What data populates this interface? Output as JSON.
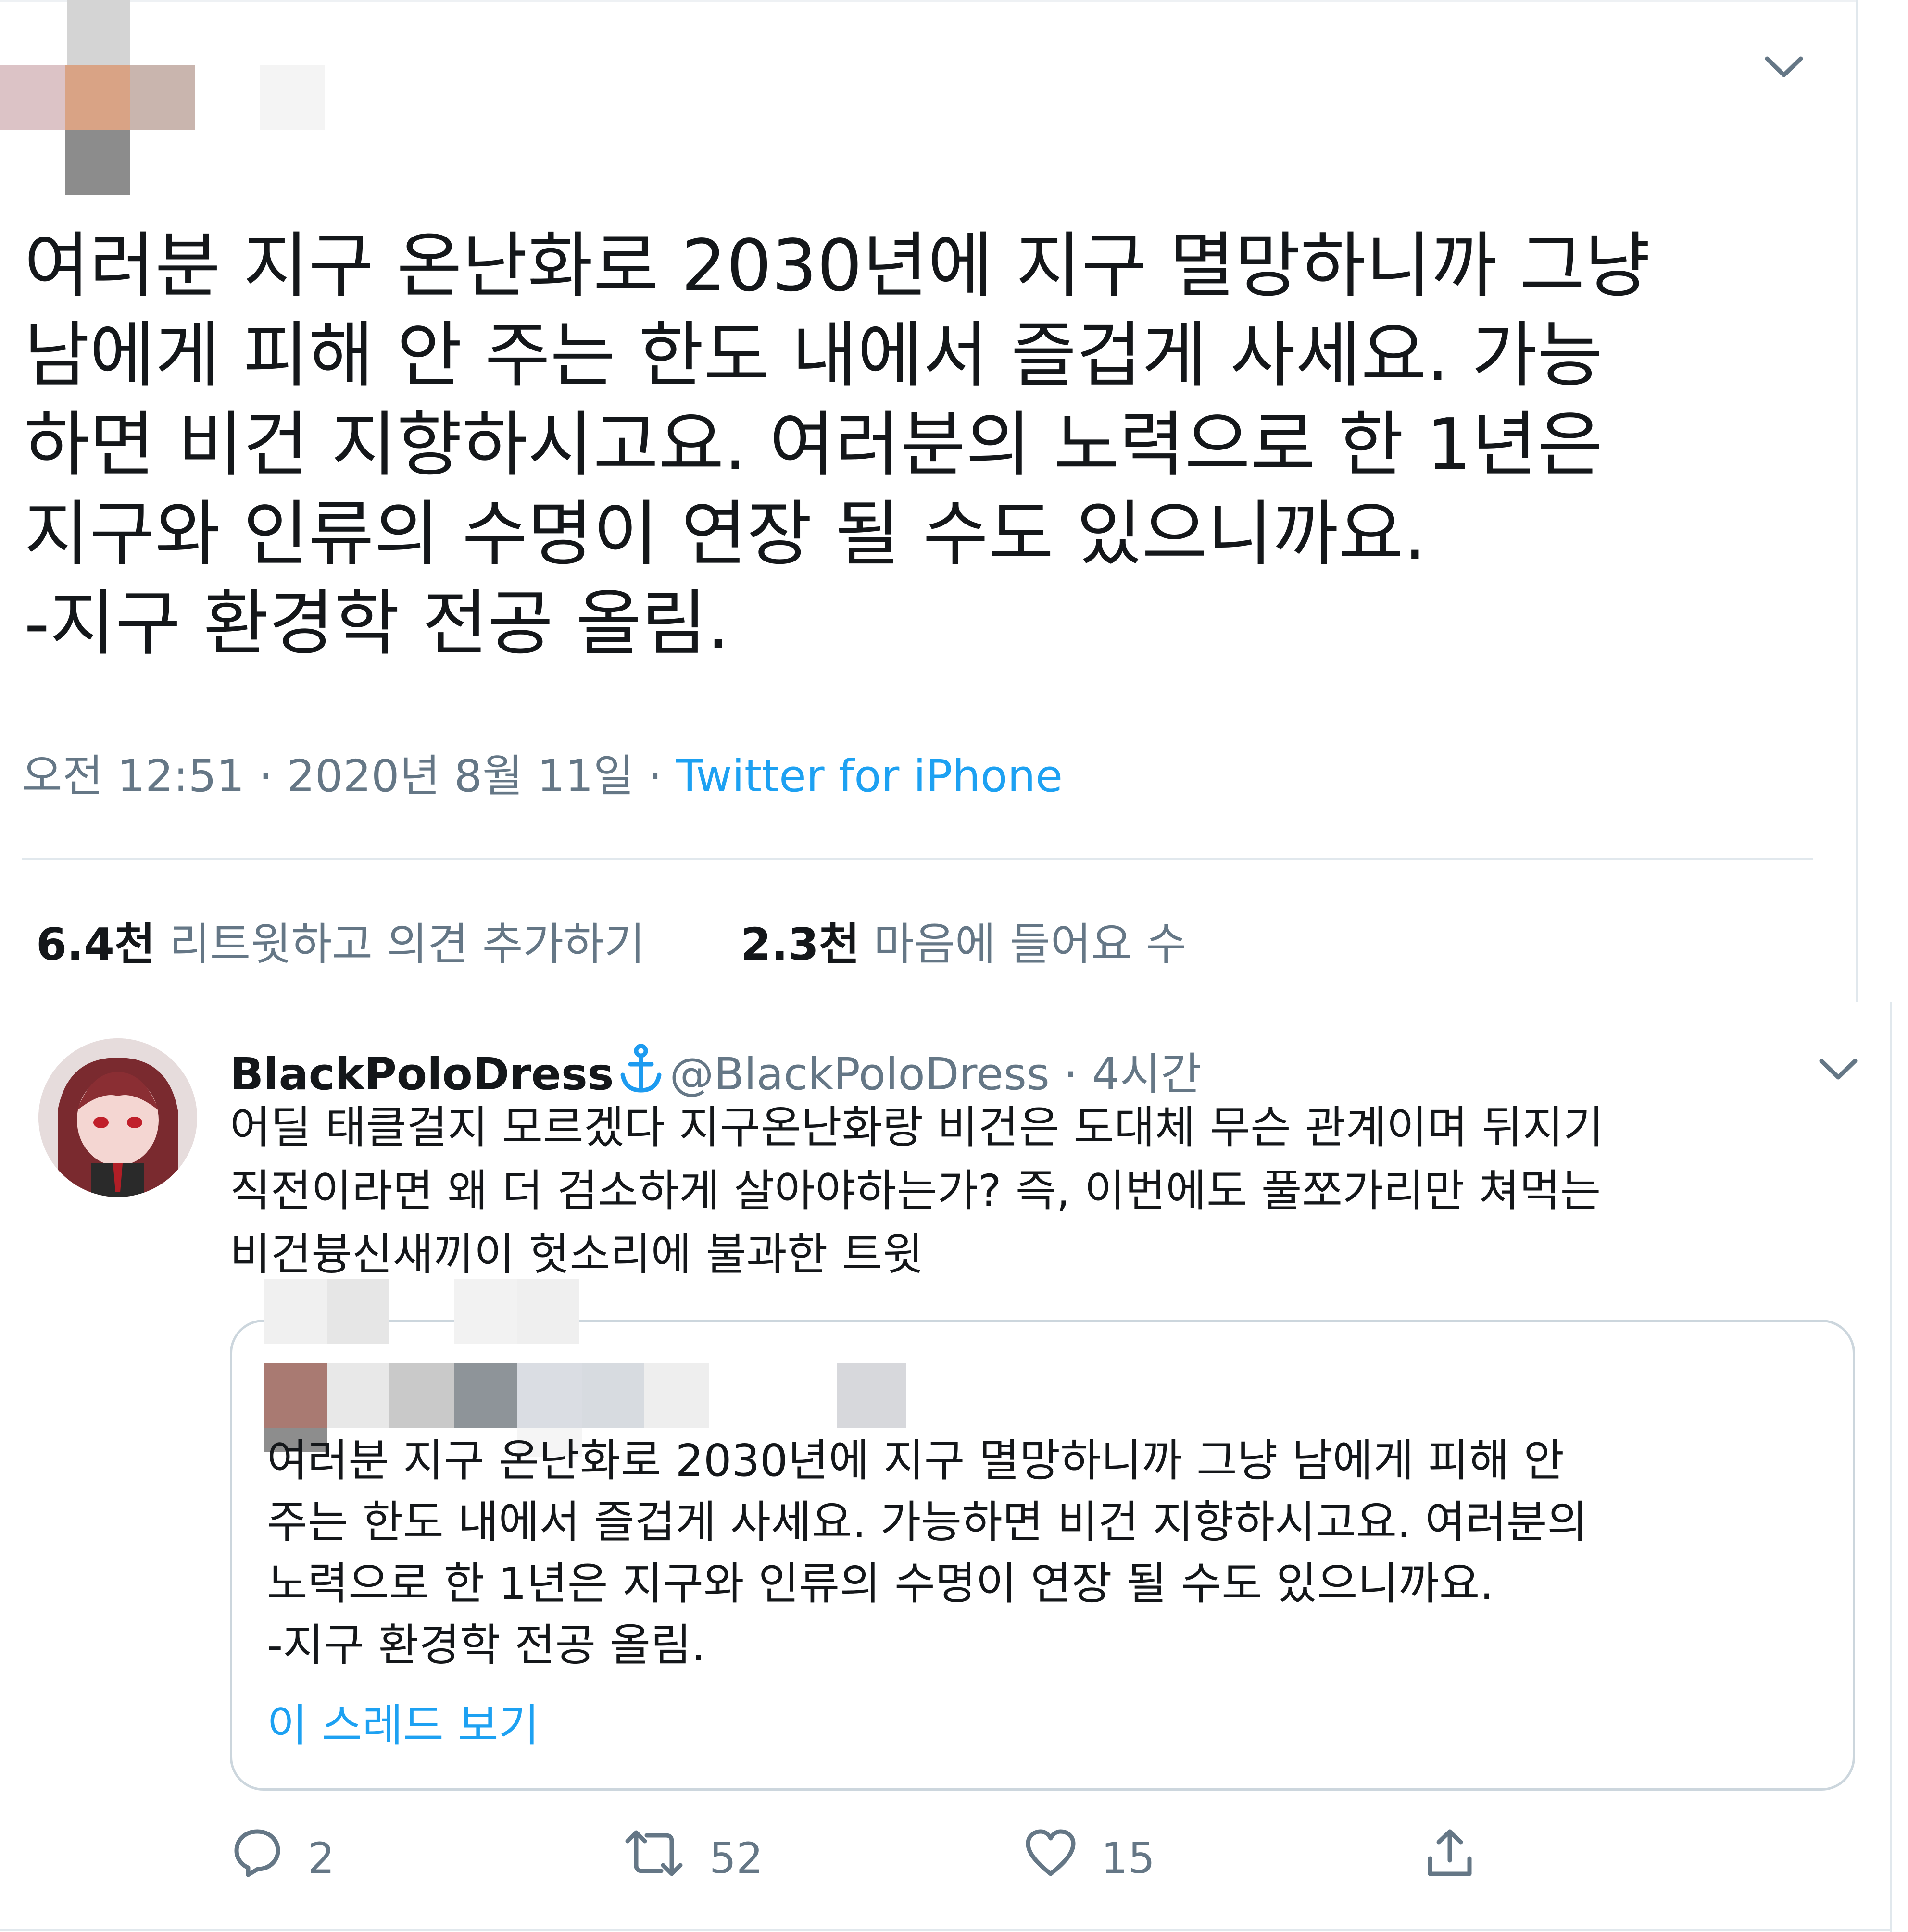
{
  "main_tweet": {
    "text_lines": [
      "여러분 지구 온난화로 2030년에 지구 멸망하니까 그냥",
      "남에게 피해 안 주는 한도 내에서 즐겁게 사세요. 가능",
      "하면 비건 지향하시고요. 여러분의 노력으로 한 1년은",
      "지구와 인류의 수명이 연장 될 수도 있으니까요.",
      "-지구 환경학 전공 올림."
    ],
    "timestamp": "오전 12:51 · 2020년 8월 11일 · ",
    "source": "Twitter for iPhone",
    "retweets_count": "6.4천",
    "retweets_label": "리트윗하고 의견 추가하기",
    "likes_count": "2.3천",
    "likes_label": "마음에 들어요 수",
    "menu_icon": "chevron-down-icon"
  },
  "reply_tweet": {
    "display_name": "BlackPoloDress",
    "badge_icon": "anchor-icon",
    "handle_time": "@BlackPoloDress · 4시간",
    "text_lines": [
      "어딜 태클걸지 모르겠다 지구온난화랑 비건은 도대체 무슨 관계이며 뒤지기",
      "직전이라면 왜 더 검소하게 살아야하는가? 즉, 이번에도 풀쪼가리만 쳐먹는",
      "비건븅신새끼이 헛소리에 불과한 트윗"
    ],
    "quote": {
      "text_lines": [
        "여러분 지구 온난화로 2030년에 지구 멸망하니까 그냥 남에게 피해 안",
        "주는 한도 내에서 즐겁게 사세요. 가능하면 비건 지향하시고요. 여러분의",
        "노력으로 한 1년은 지구와 인류의 수명이 연장 될 수도 있으니까요.",
        "-지구 환경학 전공 올림."
      ],
      "thread_link": "이 스레드 보기"
    },
    "actions": {
      "reply_count": "2",
      "retweet_count": "52",
      "like_count": "15"
    }
  },
  "colors": {
    "accent": "#1da1f2",
    "secondary_text": "#657786",
    "border": "#e1e8ed"
  }
}
